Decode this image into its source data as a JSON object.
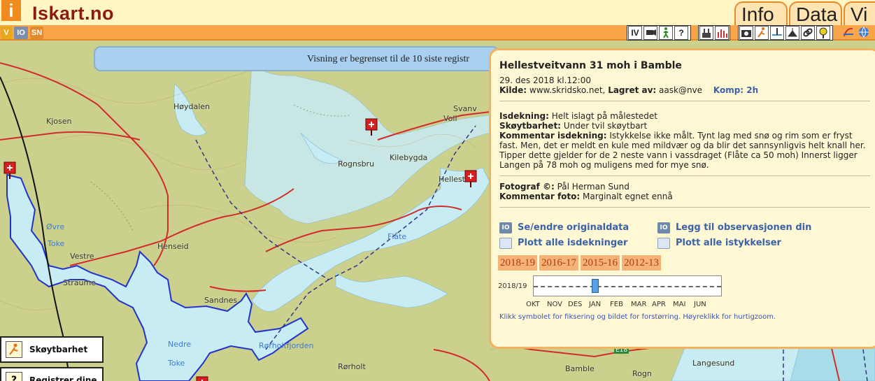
{
  "app": {
    "logo_letter": "i",
    "title": "Iskart.no",
    "tabs": [
      "Info",
      "Data",
      "Vi"
    ],
    "small_buttons": [
      "V",
      "IO",
      "SN"
    ],
    "tools": [
      "IV",
      "?"
    ]
  },
  "notice": "Visning er begrenset til de 10 siste registr",
  "map": {
    "places": [
      "Høydalen",
      "Kjosen",
      "Voll",
      "Svanv",
      "Kilebygda",
      "Rognsbru",
      "Hellest",
      "Henseid",
      "Vestre",
      "Straume",
      "Sandnes",
      "Rørholt",
      "Bamble",
      "Rogn",
      "Langesund",
      "E18"
    ],
    "waters": [
      "Øvre",
      "Toke",
      "Flåte",
      "Nedre",
      "Toke",
      "Rørholtfjorden"
    ]
  },
  "popup": {
    "title": "Hellestveitvann 31 moh i Bamble",
    "date": "29. des 2018 kl.12:00",
    "kilde_label": "Kilde:",
    "kilde_value": "www.skridsko.net,",
    "lagret_label": "Lagret av:",
    "lagret_value": "aask@nve",
    "komp": "Komp: 2h",
    "isdekning_label": "Isdekning:",
    "isdekning_value": "Helt islagt på målestedet",
    "skoytbarhet_label": "Skøytbarhet:",
    "skoytbarhet_value": "Under tvil skøytbart",
    "kommentar_label": "Kommentar isdekning:",
    "kommentar_value": "Istykkelse ikke målt. Tynt lag med snø og rim som er fryst fast. Men, det er meldt en kule med mildvær og da blir det sannsynligvis helt knall her. Tipper dette gjelder for de 2 neste vann i vassdraget (Flåte ca 50 moh) Innerst ligger Langen på 78 moh og muligens med for mye snø.",
    "fotograf_label": "Fotograf ©:",
    "fotograf_value": "Pål Herman Sund",
    "kommentar_foto_label": "Kommentar foto:",
    "kommentar_foto_value": "Marginalt egnet ennå",
    "actions": {
      "edit": "Se/endre originaldata",
      "add_obs": "Legg til observasjonen din",
      "plot_cover": "Plott alle isdekninger",
      "plot_thick": "Plott alle istykkelser"
    },
    "seasons": [
      "2018-19",
      "2016-17",
      "2015-16",
      "2012-13"
    ],
    "timeline": {
      "row_label": "2018/19",
      "months": [
        "OKT",
        "NOV",
        "DES",
        "JAN",
        "FEB",
        "MAR",
        "APR",
        "MAI",
        "JUN"
      ]
    },
    "footnote": "Klikk symbolet for fiksering og bildet for forstørring. Høyreklikk for hurtigzoom."
  },
  "legend": {
    "item1": "Skøytbarhet",
    "item2": "Registrer dine"
  },
  "colors": {
    "accent_orange": "#f9a64a",
    "title_red": "#8b1a12",
    "link_blue": "#3b62a8",
    "map_land": "#c9cf8a",
    "water": "#c8ecf4",
    "lake_outline": "#2233cc"
  }
}
